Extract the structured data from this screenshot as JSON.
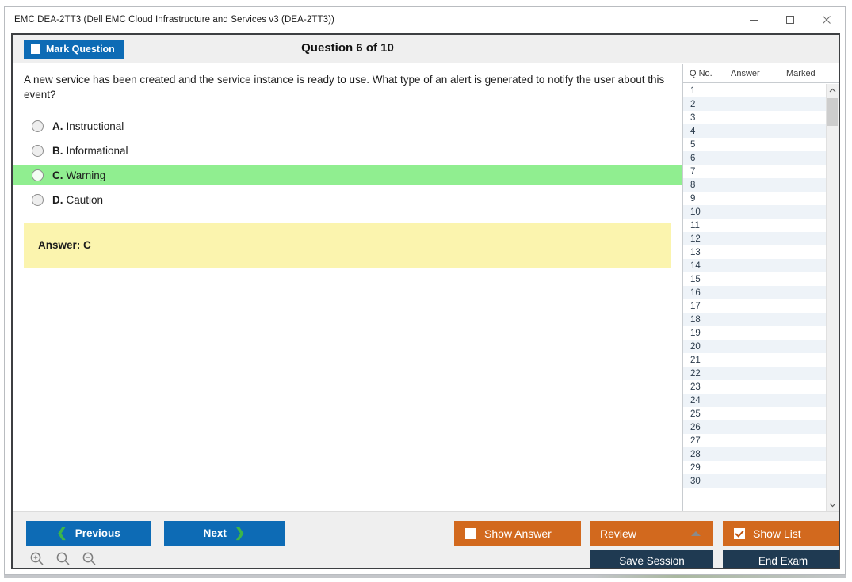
{
  "window": {
    "title": "EMC DEA-2TT3 (Dell EMC Cloud Infrastructure and Services v3 (DEA-2TT3))",
    "minimize_label": "Minimize",
    "maximize_label": "Maximize",
    "close_label": "Close"
  },
  "toolbar": {
    "mark_question_label": "Mark Question",
    "mark_question_checked": false,
    "question_counter": "Question 6 of 10"
  },
  "question": {
    "text": "A new service has been created and the service instance is ready to use. What type of an alert is generated to notify the user about this event?",
    "options": [
      {
        "letter": "A.",
        "text": "Instructional",
        "highlighted": false,
        "selected": false
      },
      {
        "letter": "B.",
        "text": "Informational",
        "highlighted": false,
        "selected": false
      },
      {
        "letter": "C.",
        "text": "Warning",
        "highlighted": true,
        "selected": false
      },
      {
        "letter": "D.",
        "text": "Caution",
        "highlighted": false,
        "selected": false
      }
    ],
    "answer_label": "Answer: C"
  },
  "list_panel": {
    "headers": {
      "q_no": "Q No.",
      "answer": "Answer",
      "marked": "Marked"
    },
    "rows": [
      {
        "q_no": "1",
        "answer": "",
        "marked": ""
      },
      {
        "q_no": "2",
        "answer": "",
        "marked": ""
      },
      {
        "q_no": "3",
        "answer": "",
        "marked": ""
      },
      {
        "q_no": "4",
        "answer": "",
        "marked": ""
      },
      {
        "q_no": "5",
        "answer": "",
        "marked": ""
      },
      {
        "q_no": "6",
        "answer": "",
        "marked": ""
      },
      {
        "q_no": "7",
        "answer": "",
        "marked": ""
      },
      {
        "q_no": "8",
        "answer": "",
        "marked": ""
      },
      {
        "q_no": "9",
        "answer": "",
        "marked": ""
      },
      {
        "q_no": "10",
        "answer": "",
        "marked": ""
      },
      {
        "q_no": "11",
        "answer": "",
        "marked": ""
      },
      {
        "q_no": "12",
        "answer": "",
        "marked": ""
      },
      {
        "q_no": "13",
        "answer": "",
        "marked": ""
      },
      {
        "q_no": "14",
        "answer": "",
        "marked": ""
      },
      {
        "q_no": "15",
        "answer": "",
        "marked": ""
      },
      {
        "q_no": "16",
        "answer": "",
        "marked": ""
      },
      {
        "q_no": "17",
        "answer": "",
        "marked": ""
      },
      {
        "q_no": "18",
        "answer": "",
        "marked": ""
      },
      {
        "q_no": "19",
        "answer": "",
        "marked": ""
      },
      {
        "q_no": "20",
        "answer": "",
        "marked": ""
      },
      {
        "q_no": "21",
        "answer": "",
        "marked": ""
      },
      {
        "q_no": "22",
        "answer": "",
        "marked": ""
      },
      {
        "q_no": "23",
        "answer": "",
        "marked": ""
      },
      {
        "q_no": "24",
        "answer": "",
        "marked": ""
      },
      {
        "q_no": "25",
        "answer": "",
        "marked": ""
      },
      {
        "q_no": "26",
        "answer": "",
        "marked": ""
      },
      {
        "q_no": "27",
        "answer": "",
        "marked": ""
      },
      {
        "q_no": "28",
        "answer": "",
        "marked": ""
      },
      {
        "q_no": "29",
        "answer": "",
        "marked": ""
      },
      {
        "q_no": "30",
        "answer": "",
        "marked": ""
      }
    ]
  },
  "bottom_bar": {
    "previous_label": "Previous",
    "next_label": "Next",
    "show_answer_label": "Show Answer",
    "show_answer_checked": false,
    "review_label": "Review",
    "show_list_label": "Show List",
    "show_list_checked": true,
    "save_session_label": "Save Session",
    "end_exam_label": "End Exam"
  },
  "colors": {
    "accent_blue": "#0d6bb5",
    "accent_orange": "#d2691e",
    "dark_navy": "#1f3a52",
    "highlight_green": "#90ee90",
    "answer_yellow": "#fbf4ae",
    "chevron_green": "#3cb54a"
  }
}
